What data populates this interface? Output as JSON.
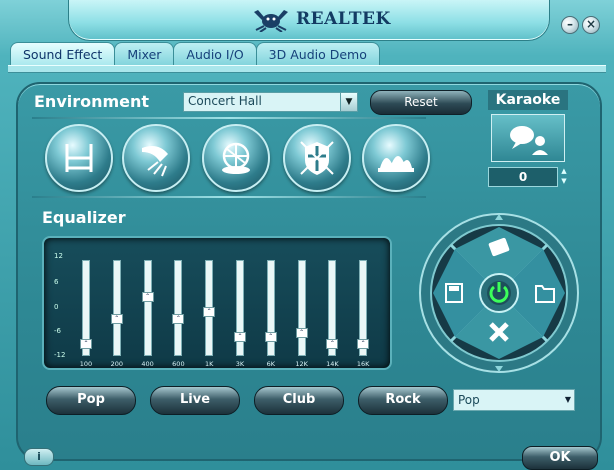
{
  "app": {
    "brand": "REALTEK"
  },
  "window_controls": {
    "minimize": "–",
    "close": "×"
  },
  "tabs": [
    {
      "label": "Sound Effect",
      "active": true
    },
    {
      "label": "Mixer"
    },
    {
      "label": "Audio I/O"
    },
    {
      "label": "3D Audio Demo"
    }
  ],
  "environment": {
    "label": "Environment",
    "selected": "Concert Hall",
    "reset_label": "Reset",
    "buttons": [
      "bathroom-icon",
      "shower-icon",
      "stadium-icon",
      "colosseum-shield-icon",
      "opera-house-icon"
    ]
  },
  "karaoke": {
    "label": "Karaoke",
    "value": "0"
  },
  "equalizer": {
    "label": "Equalizer",
    "db_ticks": [
      "12",
      "6",
      "0",
      "-6",
      "-12"
    ],
    "bands": [
      {
        "freq": "100",
        "level": -10
      },
      {
        "freq": "200",
        "level": -3
      },
      {
        "freq": "400",
        "level": 3
      },
      {
        "freq": "600",
        "level": -3
      },
      {
        "freq": "1K",
        "level": -1
      },
      {
        "freq": "3K",
        "level": -8
      },
      {
        "freq": "6K",
        "level": -8
      },
      {
        "freq": "12K",
        "level": -7
      },
      {
        "freq": "14K",
        "level": -10
      },
      {
        "freq": "16K",
        "level": -10
      }
    ],
    "presets": [
      "Pop",
      "Live",
      "Club",
      "Rock"
    ],
    "preset_select": "Pop"
  },
  "footer": {
    "info": "i",
    "ok": "OK"
  },
  "colors": {
    "accent": "#2f8f9b",
    "power": "#3cff5a"
  }
}
